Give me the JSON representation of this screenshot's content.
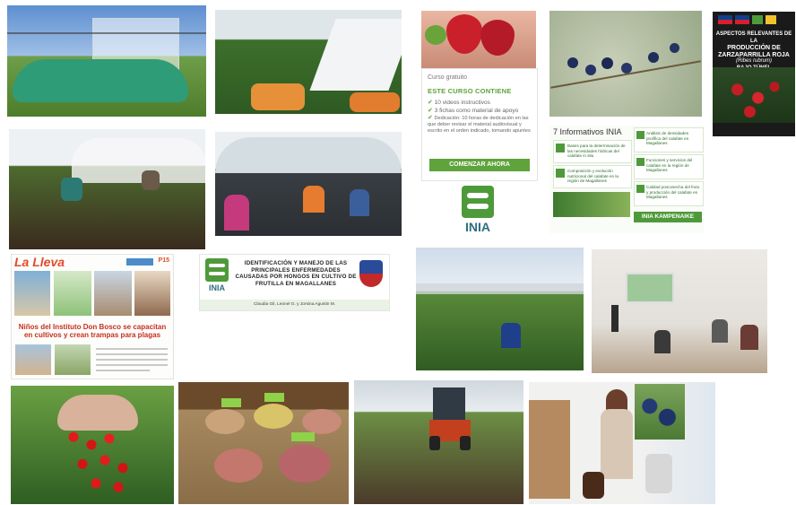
{
  "course": {
    "free_label": "Curso gratuito",
    "contains_heading": "ESTE CURSO CONTIENE",
    "items": [
      "10 videos instructivos",
      "3 fichas como material de apoyo",
      "Dedicación: 10 horas de dedicación en las que deber revisar el material audiovisual y escrito en el orden indicado, tomando apuntes"
    ],
    "cta": "COMENZAR AHORA"
  },
  "inia_logo": {
    "word": "INIA"
  },
  "informativos": {
    "heading": "7 Informativos INIA",
    "cards_left": [
      "Bases para la determinación de las necesidades hídricas del calafate in situ",
      "Composición y evolución nutricional del calafate en la región de Magallanes"
    ],
    "cards_right": [
      "Análisis de densidades prolífica del calafate en Magallanes",
      "Funciones y servicios del calafate en la región de Magallanes",
      "Calidad poscosecha del fruto y producción del calafate en Magallanes"
    ],
    "footer_brand": "INIA KAMPENAIKE"
  },
  "book": {
    "title_lines": [
      "ASPECTOS RELEVANTES DE LA",
      "PRODUCCIÓN DE",
      "ZARZAPARRILLA ROJA",
      "(Ribes rubrum)",
      "BAJO TÚNEL"
    ]
  },
  "newspaper": {
    "brand": "La Lleva",
    "page": "P15",
    "headline": "Niños del Instituto Don Bosco se capacitan en cultivos y crean trampas para plagas"
  },
  "banner": {
    "title": "IDENTIFICACIÓN Y MANEJO DE LAS PRINCIPALES ENFERMEDADES CAUSADAS POR HONGOS EN CULTIVO DE FRUTILLA EN MAGALLANES",
    "authors": "Claudia Gil, Leonel G. y Jorsina Agustin M.",
    "logo_word": "INIA"
  },
  "colors": {
    "inia_green": "#4e9a3a",
    "inia_teal": "#2e6e7e",
    "cta_green": "#5ea33b",
    "news_red": "#c62f1e"
  }
}
